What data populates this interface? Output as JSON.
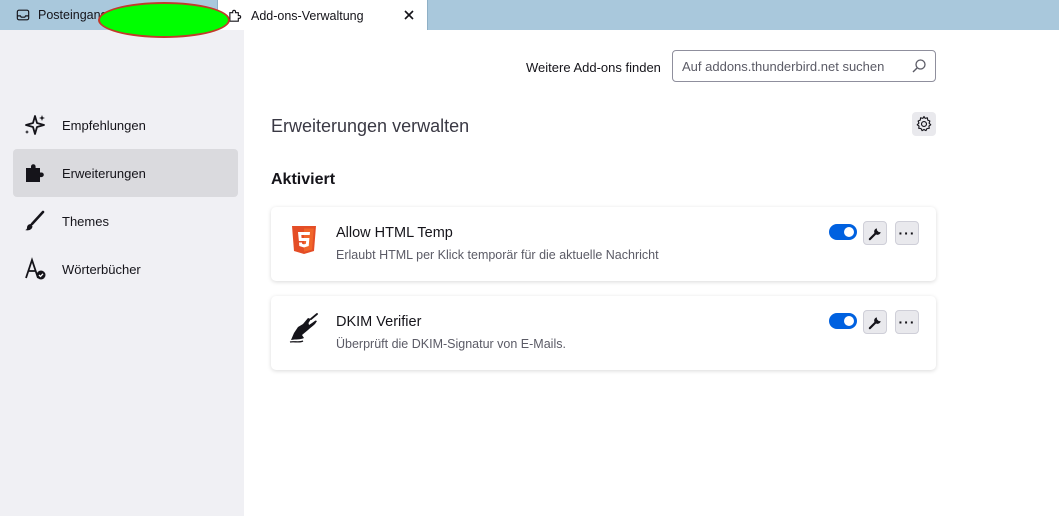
{
  "tabs": [
    {
      "label": "Posteingang",
      "icon": "inbox-icon"
    },
    {
      "label": "Add-ons-Verwaltung",
      "icon": "puzzle-icon"
    }
  ],
  "sidebar": {
    "items": [
      {
        "label": "Empfehlungen",
        "icon": "sparkle-icon",
        "selected": false
      },
      {
        "label": "Erweiterungen",
        "icon": "puzzle-icon",
        "selected": true
      },
      {
        "label": "Themes",
        "icon": "brush-icon",
        "selected": false
      },
      {
        "label": "Wörterbücher",
        "icon": "dictionary-icon",
        "selected": false
      }
    ]
  },
  "main": {
    "find_label": "Weitere Add-ons finden",
    "search_placeholder": "Auf addons.thunderbird.net suchen",
    "page_heading": "Erweiterungen verwalten",
    "section_heading": "Aktiviert",
    "addons": [
      {
        "name": "Allow HTML Temp",
        "description": "Erlaubt HTML per Klick temporär für die aktuelle Nachricht",
        "enabled": true,
        "icon": "html5-icon"
      },
      {
        "name": "DKIM Verifier",
        "description": "Überprüft die DKIM-Signatur von E-Mails.",
        "enabled": true,
        "icon": "signature-hand-icon"
      }
    ],
    "more_label": "···"
  },
  "colors": {
    "accent": "#0061e0",
    "tabstrip": "#a9c8dc",
    "html5": "#e44d26"
  }
}
